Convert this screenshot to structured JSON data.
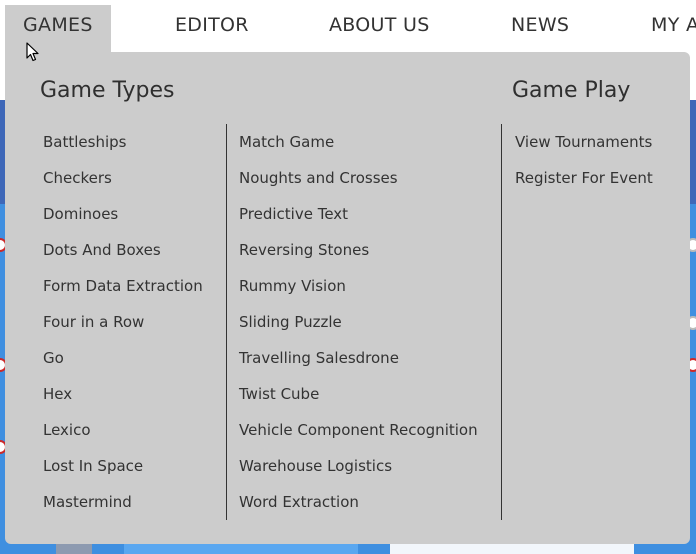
{
  "nav": {
    "items": [
      {
        "label": "GAMES"
      },
      {
        "label": "EDITOR"
      },
      {
        "label": "ABOUT US"
      },
      {
        "label": "NEWS"
      },
      {
        "label": "MY A"
      }
    ]
  },
  "dropdown": {
    "game_types_title": "Game Types",
    "game_play_title": "Game Play",
    "game_types_col1": [
      "Battleships",
      "Checkers",
      "Dominoes",
      "Dots And Boxes",
      "Form Data Extraction",
      "Four in a Row",
      "Go",
      "Hex",
      "Lexico",
      "Lost In Space",
      "Mastermind"
    ],
    "game_types_col2": [
      "Match Game",
      "Noughts and Crosses",
      "Predictive Text",
      "Reversing Stones",
      "Rummy Vision",
      "Sliding Puzzle",
      "Travelling Salesdrone",
      "Twist Cube",
      "Vehicle Component Recognition",
      "Warehouse Logistics",
      "Word Extraction"
    ],
    "game_play": [
      "View Tournaments",
      "Register For Event"
    ]
  },
  "colors": {
    "nav_active_bg": "#cccccc",
    "dropdown_bg": "#cccccc",
    "page_blue": "#3f8fe0",
    "page_band": "#3e67b8"
  }
}
